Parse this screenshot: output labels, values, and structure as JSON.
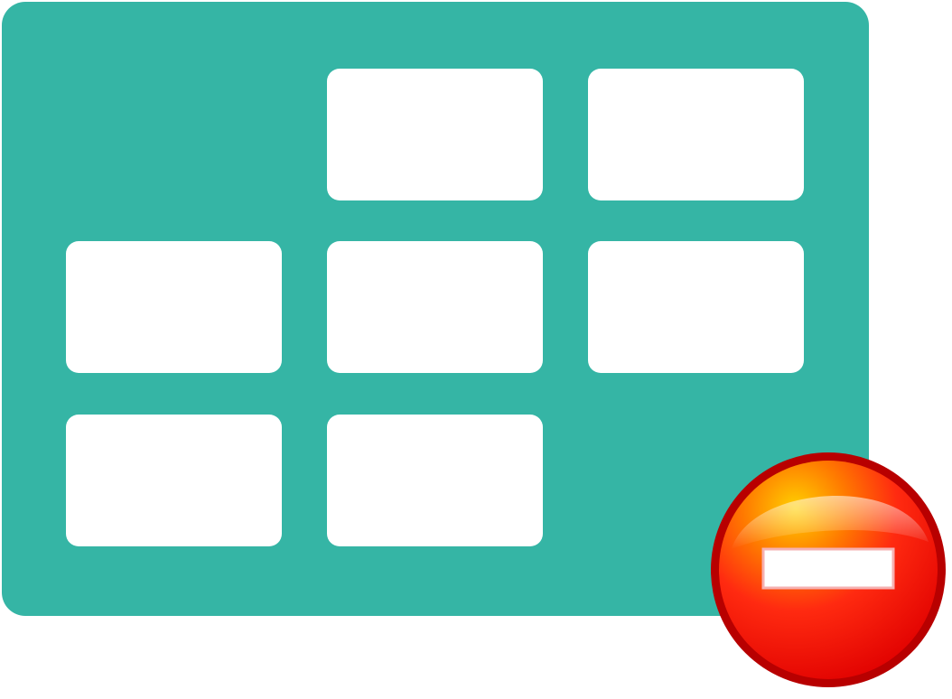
{
  "icon": {
    "name": "remove-table-icon",
    "grid": {
      "rows": [
        [
          false,
          true,
          true
        ],
        [
          true,
          true,
          true
        ],
        [
          true,
          true,
          false
        ]
      ]
    },
    "badge": "minus-circle-icon"
  },
  "colors": {
    "card": "#35b5a5",
    "cell": "#ffffff",
    "badge_red": "#ff1a12",
    "badge_rim": "#b80000",
    "badge_highlight": "#ffd000",
    "minus_bar": "#ffffff"
  }
}
